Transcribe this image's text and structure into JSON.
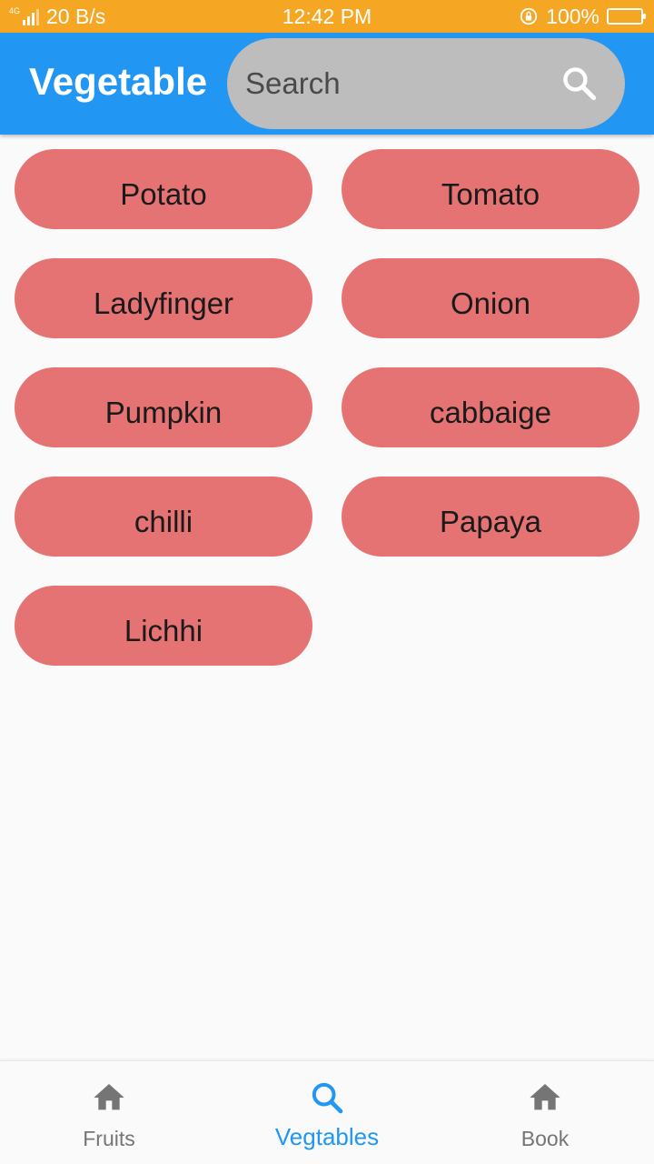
{
  "status_bar": {
    "network": "4G",
    "speed": "20 B/s",
    "time": "12:42 PM",
    "battery": "100%"
  },
  "app_bar": {
    "title": "Vegetable",
    "search": {
      "placeholder": "Search",
      "value": ""
    },
    "search_icon": "search-icon"
  },
  "items": [
    {
      "label": "Potato"
    },
    {
      "label": "Tomato"
    },
    {
      "label": "Ladyfinger"
    },
    {
      "label": "Onion"
    },
    {
      "label": "Pumpkin"
    },
    {
      "label": "cabbaige"
    },
    {
      "label": "chilli"
    },
    {
      "label": "Papaya"
    },
    {
      "label": "Lichhi"
    }
  ],
  "bottom_nav": [
    {
      "label": "Fruits",
      "icon": "home-icon",
      "active": false
    },
    {
      "label": "Vegtables",
      "icon": "search-icon",
      "active": true
    },
    {
      "label": "Book",
      "icon": "home-icon",
      "active": false
    }
  ],
  "colors": {
    "status_bar": "#f5a623",
    "app_bar": "#2196f3",
    "chip": "#e57373",
    "search_box": "#bdbdbd",
    "nav_active": "#2196f3",
    "nav_inactive": "#757575"
  }
}
